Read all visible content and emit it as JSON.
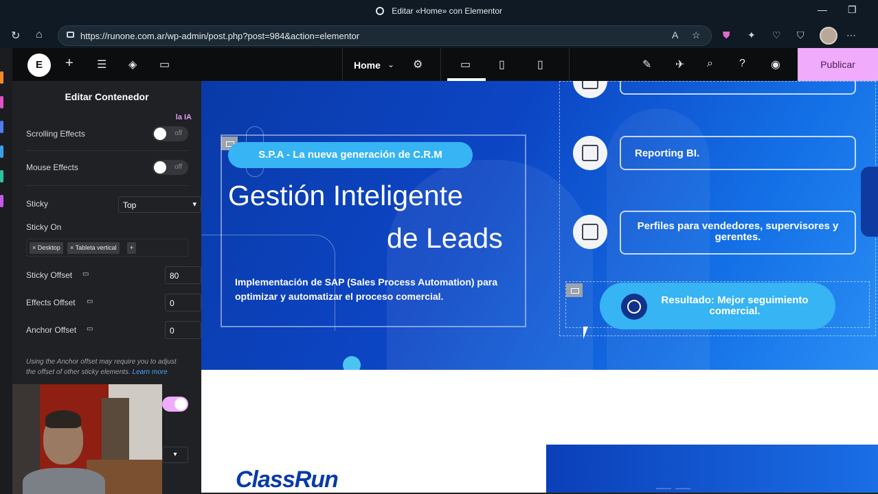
{
  "browser": {
    "window_title": "Editar «Home» con Elementor",
    "url": "https://runone.com.ar/wp-admin/post.php?post=984&action=elementor"
  },
  "elementor": {
    "document_name": "Home",
    "publish_label": "Publicar"
  },
  "panel": {
    "title": "Editar Contenedor",
    "ai_label": "la IA",
    "scrolling_effects": {
      "label": "Scrolling Effects",
      "state": "off"
    },
    "mouse_effects": {
      "label": "Mouse Effects",
      "state": "off"
    },
    "sticky": {
      "label": "Sticky",
      "value": "Top"
    },
    "sticky_on": {
      "label": "Sticky On",
      "tags": [
        "× Desktop",
        "× Tableta vertical"
      ],
      "add": "+"
    },
    "sticky_offset": {
      "label": "Sticky Offset",
      "value": "80"
    },
    "effects_offset": {
      "label": "Effects Offset",
      "value": "0"
    },
    "anchor_offset": {
      "label": "Anchor Offset",
      "value": "0"
    },
    "note": "Using the Anchor offset may require you to adjust the offset of other sticky elements.",
    "note_link": "Learn more"
  },
  "canvas": {
    "tagline": "S.P.A - La nueva generación de C.R.M",
    "heading_line1": "Gestión Inteligente",
    "heading_line2": "de Leads",
    "description": "Implementación de SAP (Sales Process Automation) para optimizar y automatizar el proceso comercial.",
    "features": [
      {
        "label": "Reporting BI.",
        "icon": "chart-icon"
      },
      {
        "label": "Perfiles para vendedores, supervisores y gerentes.",
        "icon": "profiles-icon"
      }
    ],
    "result": "Resultado: Mejor seguimiento comercial.",
    "logo_text": "ClassRun"
  },
  "colors": {
    "publish_bg": "#f0abfc",
    "hero_blue": "#0c45c4",
    "pill_blue": "#36b4f3",
    "panel_bg": "#1f2124"
  }
}
